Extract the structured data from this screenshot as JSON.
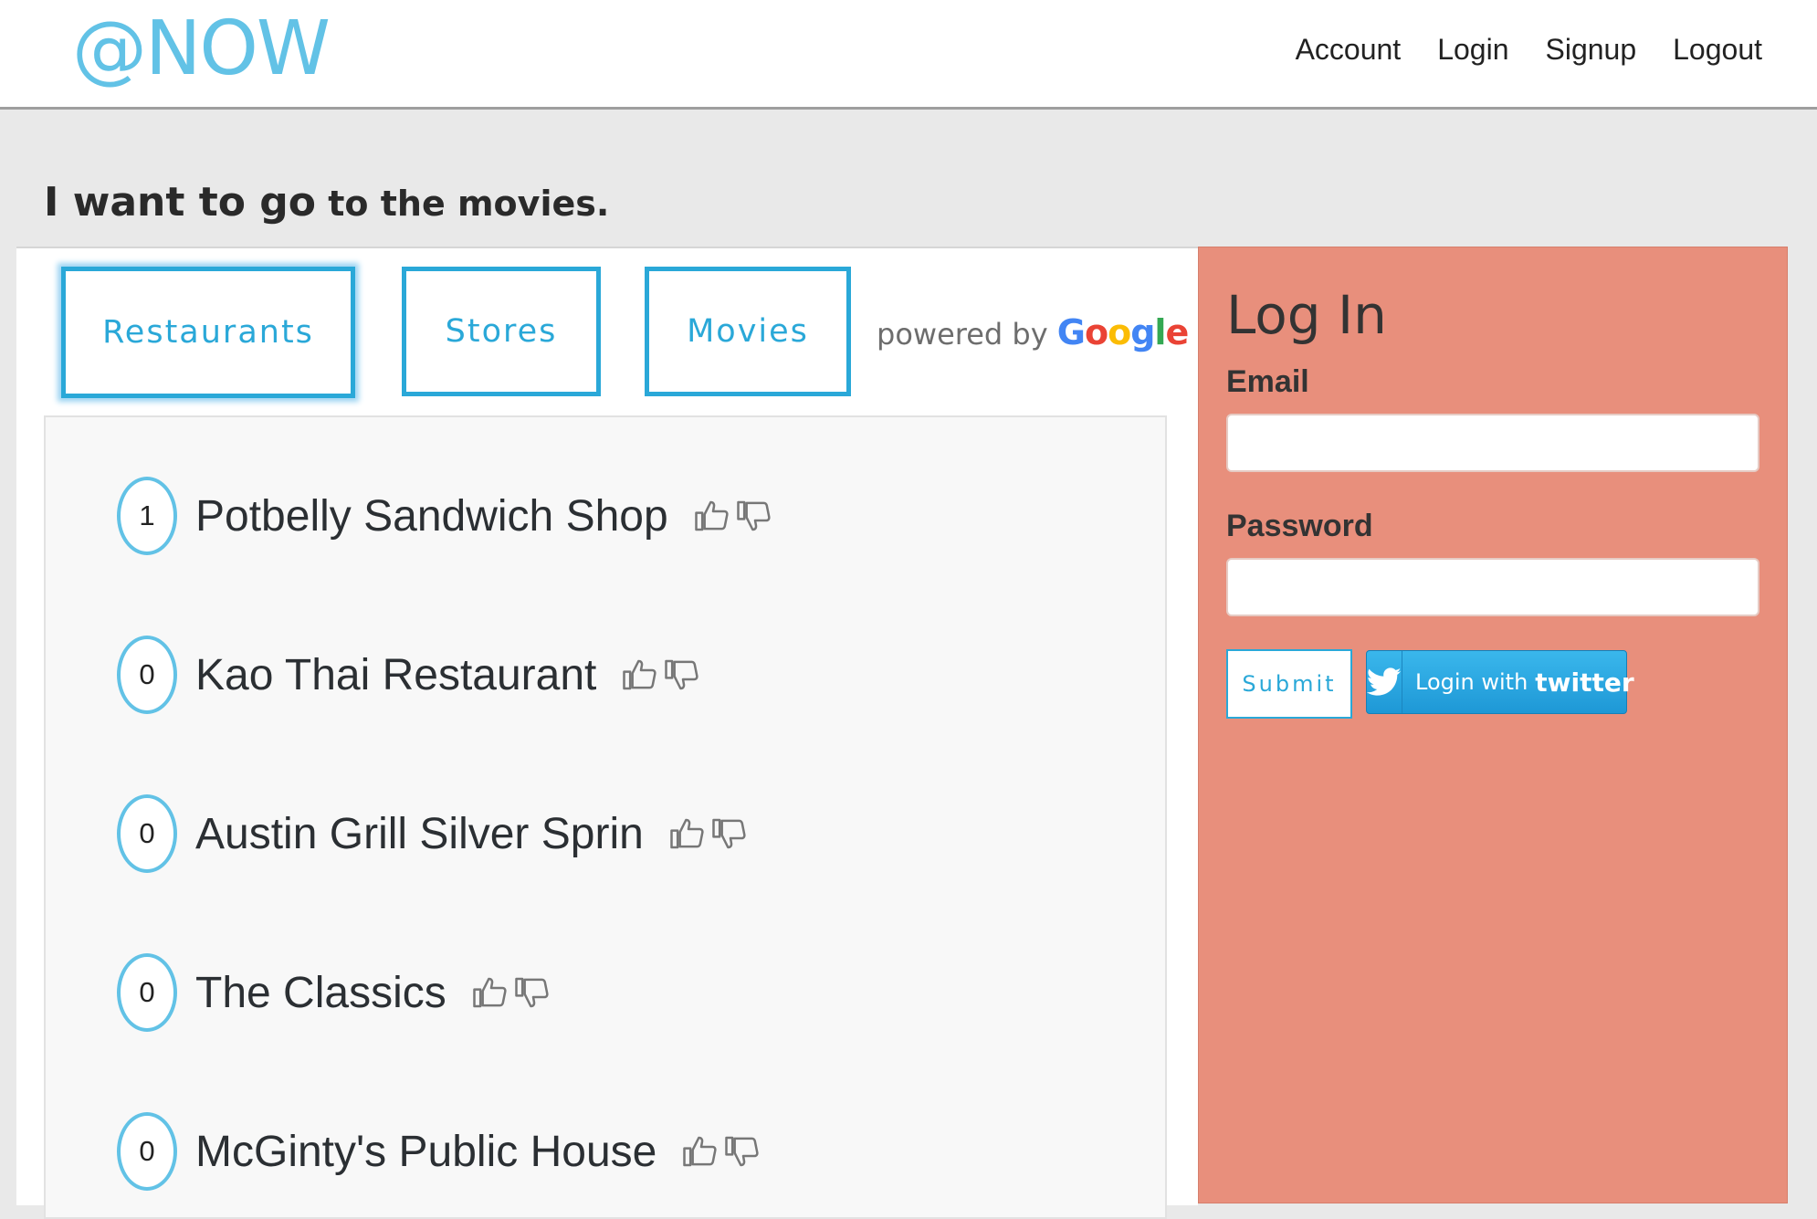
{
  "brand": {
    "logo": "@NOW"
  },
  "nav": {
    "items": [
      {
        "label": "Account"
      },
      {
        "label": "Login"
      },
      {
        "label": "Signup"
      },
      {
        "label": "Logout"
      }
    ]
  },
  "headline": {
    "part1": "I want to go",
    "part2": " to the movies."
  },
  "categories": {
    "items": [
      {
        "label": "Restaurants",
        "active": true
      },
      {
        "label": "Stores",
        "active": false
      },
      {
        "label": "Movies",
        "active": false
      }
    ],
    "powered_by": "powered by",
    "google": "Google"
  },
  "places": [
    {
      "votes": "1",
      "name": "Potbelly Sandwich Shop"
    },
    {
      "votes": "0",
      "name": "Kao Thai Restaurant"
    },
    {
      "votes": "0",
      "name": "Austin Grill Silver Sprin"
    },
    {
      "votes": "0",
      "name": "The Classics"
    },
    {
      "votes": "0",
      "name": "McGinty's Public House"
    }
  ],
  "login": {
    "title": "Log In",
    "email_label": "Email",
    "email_value": "",
    "password_label": "Password",
    "password_value": "",
    "submit_label": "Submit",
    "twitter_prefix": "Login with",
    "twitter_brand": "twitter"
  },
  "colors": {
    "accent": "#2aa8d8",
    "logo": "#62c2e6",
    "login_panel": "#e88f7c",
    "google": [
      "#4285F4",
      "#EA4335",
      "#FBBC05",
      "#4285F4",
      "#34A853",
      "#EA4335"
    ]
  },
  "icons": {
    "vote_up": "thumbs-up-icon",
    "vote_down": "thumbs-down-icon",
    "twitter": "twitter-bird-icon"
  }
}
